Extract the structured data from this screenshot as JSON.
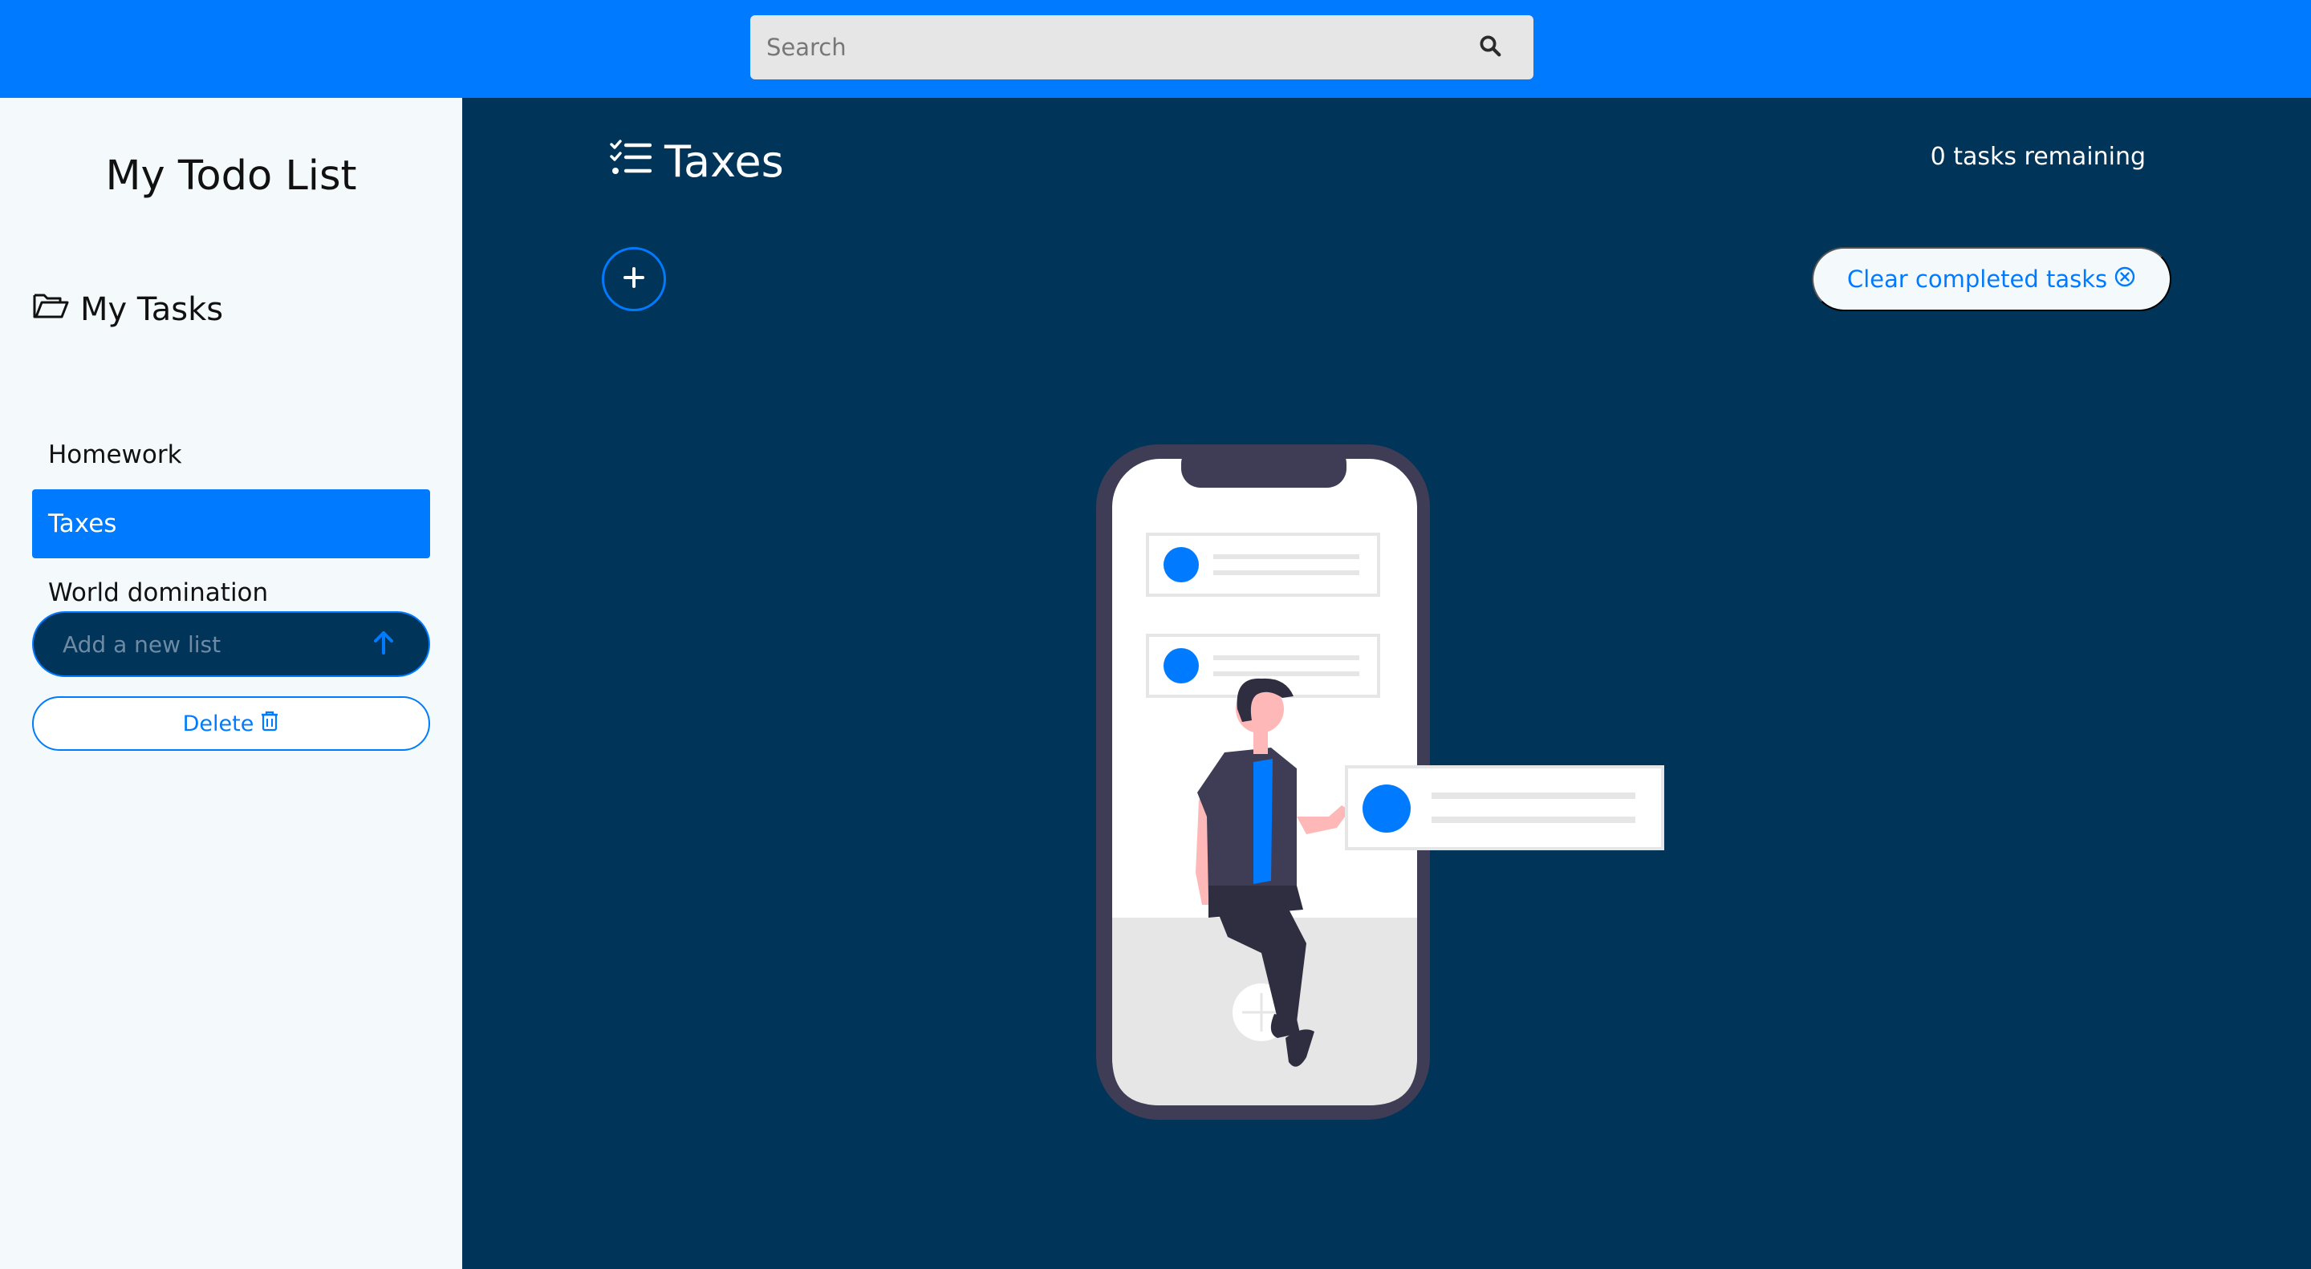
{
  "search": {
    "placeholder": "Search",
    "icon": "search-icon"
  },
  "sidebar": {
    "title": "My Todo List",
    "section_heading": "My Tasks",
    "section_icon": "folder-open-icon",
    "lists": [
      {
        "label": "Homework",
        "active": false
      },
      {
        "label": "Taxes",
        "active": true
      },
      {
        "label": "World domination",
        "active": false
      }
    ],
    "new_list_placeholder": "Add a new list",
    "delete_label": "Delete"
  },
  "main": {
    "list_title": "Taxes",
    "list_icon": "task-list-icon",
    "tasks_remaining": "0 tasks remaining",
    "add_task_icon": "plus-icon",
    "clear_label": "Clear completed tasks",
    "illustration": "empty-tasks-illustration"
  },
  "colors": {
    "accent": "#007bff",
    "main_bg": "#003459",
    "sidebar_bg": "#f4fafc"
  }
}
